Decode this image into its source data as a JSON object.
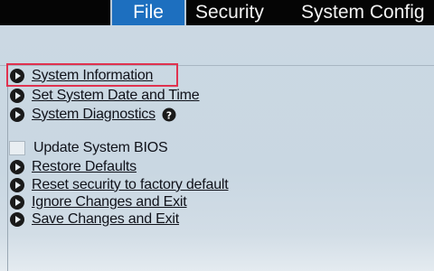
{
  "menu": {
    "tabs": [
      {
        "label": "File",
        "active": true
      },
      {
        "label": "Security",
        "active": false
      },
      {
        "label": "System Config",
        "active": false
      }
    ]
  },
  "file_menu": {
    "items": [
      {
        "label": "System Information",
        "icon": "arrow-bullet-icon",
        "highlighted": true
      },
      {
        "label": "Set System Date and Time",
        "icon": "arrow-bullet-icon"
      },
      {
        "label": "System Diagnostics",
        "icon": "arrow-bullet-icon",
        "help_icon": "help-icon"
      },
      {
        "label": "Update System BIOS",
        "icon": "checkbox-icon"
      },
      {
        "label": "Restore Defaults",
        "icon": "arrow-bullet-icon"
      },
      {
        "label": "Reset security to factory default",
        "icon": "arrow-bullet-icon"
      },
      {
        "label": "Ignore Changes and Exit",
        "icon": "arrow-bullet-icon"
      },
      {
        "label": "Save Changes and Exit",
        "icon": "arrow-bullet-icon"
      }
    ]
  },
  "colors": {
    "active_tab": "#1d6fbf",
    "menu_bar": "#050505",
    "background": "#c8d6e1",
    "highlight_border": "#e0324f"
  }
}
